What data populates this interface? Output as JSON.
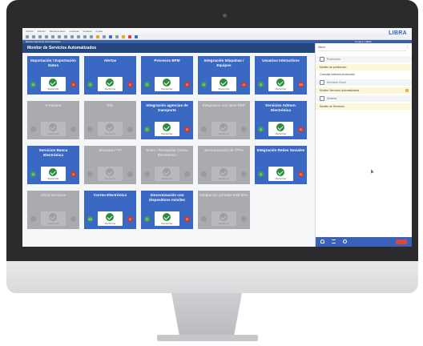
{
  "app": {
    "logo_text": "LIBRA",
    "menu_items": [
      "Archivo",
      "Edición",
      "Mantenimiento",
      "Consulta",
      "Ventana",
      "Ayuda"
    ],
    "breadcrumb": "Monitor Servicios Automatizados",
    "user_info": "Usuario: LIBRA"
  },
  "panel": {
    "title": "Monitor de Servicios Automatizados"
  },
  "tiles": [
    {
      "title": "Importación / Exportación Datos",
      "active": true,
      "ok": "5",
      "err": "6",
      "status": "Monitorizar"
    },
    {
      "title": "Alertas",
      "active": true,
      "ok": "9",
      "err": "6",
      "status": "Monitorizar"
    },
    {
      "title": "Procesos BPM",
      "active": true,
      "ok": "9",
      "err": "6",
      "status": "Monitorizar"
    },
    {
      "title": "Integración Máquinas / Equipos",
      "active": true,
      "ok": "5",
      "err": "6",
      "status": "Monitorizar"
    },
    {
      "title": "Usuarios Interactivos",
      "active": true,
      "ok": "9",
      "err": "39",
      "status": "Monitorizar"
    },
    {
      "title": "e-Factura",
      "active": false,
      "ok": "",
      "err": "",
      "status": "Monitorizar"
    },
    {
      "title": "EDI",
      "active": false,
      "ok": "",
      "err": "",
      "status": "Monitorizar"
    },
    {
      "title": "Integración agencias de transporte",
      "active": true,
      "ok": "5",
      "err": "6",
      "status": "Monitorizar"
    },
    {
      "title": "Integración con otros ERP",
      "active": false,
      "ok": "",
      "err": "",
      "status": "Monitorizar"
    },
    {
      "title": "Servicios Admon. Electrónica",
      "active": true,
      "ok": "9",
      "err": "6",
      "status": "Monitorizar"
    },
    {
      "title": "Servicios Banca Electrónica",
      "active": true,
      "ok": "5",
      "err": "6",
      "status": "Monitorizar"
    },
    {
      "title": "Servicios FTP",
      "active": false,
      "ok": "",
      "err": "",
      "status": "Monitorizar"
    },
    {
      "title": "Envío / Recepción Correo Electrónico",
      "active": false,
      "ok": "",
      "err": "",
      "status": "Monitorizar"
    },
    {
      "title": "Sincronización de TPVs",
      "active": false,
      "ok": "",
      "err": "",
      "status": "Monitorizar"
    },
    {
      "title": "Integración Redes Sociales",
      "active": true,
      "ok": "9",
      "err": "6",
      "status": "Monitorizar"
    },
    {
      "title": "Otros Servicios",
      "active": false,
      "ok": "",
      "err": "",
      "status": "Monitorizar"
    },
    {
      "title": "Correo Electrónico",
      "active": true,
      "ok": "10",
      "err": "6",
      "status": "Monitorizar"
    },
    {
      "title": "Sincronización con dispositivos móviles",
      "active": true,
      "ok": "5",
      "err": "6",
      "status": "Monitorizar"
    },
    {
      "title": "Integración portales B2B-B2C",
      "active": false,
      "ok": "",
      "err": "",
      "status": "Monitorizar"
    }
  ],
  "side": {
    "search_label": "Menu",
    "rows": [
      {
        "label": "Producción",
        "kind": "header"
      },
      {
        "label": "Modelo de producción",
        "kind": "fav"
      },
      {
        "label": "Consulta órdenes producción",
        "kind": "item"
      },
      {
        "label": "Servicios Cloud",
        "kind": "header"
      },
      {
        "label": "Monitor Servicios Automatizados",
        "kind": "fav"
      },
      {
        "label": "Sistema",
        "kind": "header"
      },
      {
        "label": "Modelo de Servicios",
        "kind": "fav"
      }
    ]
  },
  "colors": {
    "tile_active": "#3b68c3",
    "tile_inactive": "#a9abaf",
    "ok": "#3ca44a",
    "error": "#d63b30",
    "header": "#25477f"
  }
}
